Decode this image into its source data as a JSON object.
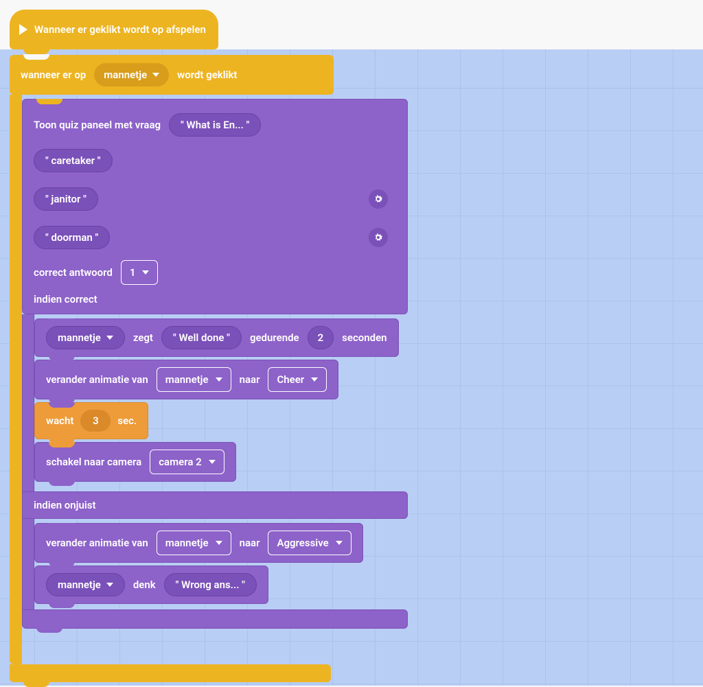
{
  "hat": {
    "label": "Wanneer er geklikt wordt op afspelen"
  },
  "click_event": {
    "prefix": "wanneer er op",
    "target": "mannetje",
    "suffix": "wordt geklikt"
  },
  "quiz": {
    "label": "Toon quiz paneel met vraag",
    "question": "\"  What is  En...   \"",
    "answers": [
      "\"  caretaker  \"",
      "\"  janitor  \"",
      "\"  doorman  \""
    ],
    "correct_label": "correct antwoord",
    "correct_value": "1",
    "if_correct_label": "indien correct",
    "if_wrong_label": "indien onjuist"
  },
  "correct_branch": {
    "say": {
      "actor": "mannetje",
      "verb": "zegt",
      "text": "\"  Well done  \"",
      "for": "gedurende",
      "seconds_val": "2",
      "seconds_unit": "seconden"
    },
    "anim": {
      "label": "verander animatie van",
      "actor": "mannetje",
      "to": "naar",
      "animation": "Cheer"
    },
    "wait": {
      "label": "wacht",
      "value": "3",
      "unit": "sec."
    },
    "camera": {
      "label": "schakel naar camera",
      "value": "camera 2"
    }
  },
  "wrong_branch": {
    "anim": {
      "label": "verander animatie van",
      "actor": "mannetje",
      "to": "naar",
      "animation": "Aggressive"
    },
    "think": {
      "actor": "mannetje",
      "verb": "denk",
      "text": "\"  Wrong ans...  \""
    }
  }
}
